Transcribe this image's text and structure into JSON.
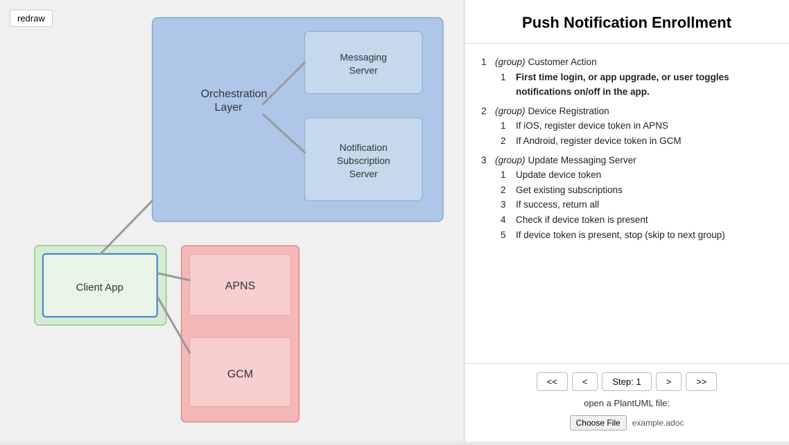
{
  "left": {
    "redraw_label": "redraw"
  },
  "right": {
    "title": "Push Notification Enrollment",
    "steps": [
      {
        "num": "1",
        "group_label": "(group)",
        "group_name": "Customer Action",
        "sub_steps": [
          {
            "num": "1",
            "text": "First time login, or app upgrade, or user toggles notifications on/off in the app.",
            "bold": true
          }
        ]
      },
      {
        "num": "2",
        "group_label": "(group)",
        "group_name": "Device Registration",
        "sub_steps": [
          {
            "num": "1",
            "text": "If iOS, register device token in APNS",
            "bold": false
          },
          {
            "num": "2",
            "text": "If Android, register device token in GCM",
            "bold": false
          }
        ]
      },
      {
        "num": "3",
        "group_label": "(group)",
        "group_name": "Update Messaging Server",
        "sub_steps": [
          {
            "num": "1",
            "text": "Update device token",
            "bold": false
          },
          {
            "num": "2",
            "text": "Get existing subscriptions",
            "bold": false
          },
          {
            "num": "3",
            "text": "If success, return all",
            "bold": false
          },
          {
            "num": "4",
            "text": "Check if device token is present",
            "bold": false
          },
          {
            "num": "5",
            "text": "If device token is present, stop (skip to next group)",
            "bold": false
          }
        ]
      }
    ],
    "nav": {
      "first_label": "<<",
      "prev_label": "<",
      "step_label": "Step: 1",
      "next_label": ">",
      "last_label": ">>",
      "file_prompt": "open a PlantUML file:",
      "choose_file_label": "Choose File",
      "file_name": "example.adoc"
    }
  },
  "diagram": {
    "orchestration_layer": "Orchestration Layer",
    "messaging_server": "Messaging\nServer",
    "notification_server": "Notification\nSubscription\nServer",
    "client_app": "Client App",
    "apns": "APNS",
    "gcm": "GCM"
  }
}
